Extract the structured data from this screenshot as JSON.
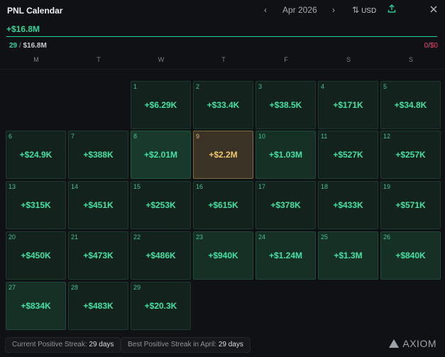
{
  "header": {
    "title": "PNL Calendar",
    "prev_icon": "chevron-left-icon",
    "next_icon": "chevron-right-icon",
    "month_label": "Apr 2026",
    "currency_label": "USD",
    "swap_icon": "swap-vertical-icon",
    "share_icon": "share-upload-icon",
    "close_icon": "close-icon"
  },
  "summary": {
    "total": "+$16.8M",
    "positive_days": "29",
    "positive_total": "$16.8M",
    "negative_days": "0",
    "negative_total": "$0",
    "separator": "/",
    "accent_color": "#31d49a",
    "negative_color": "#ff3c6e",
    "positive_fraction": 1.0
  },
  "weekdays": [
    "M",
    "T",
    "W",
    "T",
    "F",
    "S",
    "S"
  ],
  "days": [
    {
      "day": "1",
      "value": "+$6.29K",
      "tone": "dark"
    },
    {
      "day": "2",
      "value": "+$33.4K",
      "tone": "dark"
    },
    {
      "day": "3",
      "value": "+$38.5K",
      "tone": "dark"
    },
    {
      "day": "4",
      "value": "+$171K",
      "tone": "dark"
    },
    {
      "day": "5",
      "value": "+$34.8K",
      "tone": "dark"
    },
    {
      "day": "6",
      "value": "+$24.9K",
      "tone": "dark"
    },
    {
      "day": "7",
      "value": "+$388K",
      "tone": "dark"
    },
    {
      "day": "8",
      "value": "+$2.01M",
      "tone": "light"
    },
    {
      "day": "9",
      "value": "+$2.2M",
      "tone": "today"
    },
    {
      "day": "10",
      "value": "+$1.03M",
      "tone": "mid"
    },
    {
      "day": "11",
      "value": "+$527K",
      "tone": "dark"
    },
    {
      "day": "12",
      "value": "+$257K",
      "tone": "dark"
    },
    {
      "day": "13",
      "value": "+$315K",
      "tone": "dark"
    },
    {
      "day": "14",
      "value": "+$451K",
      "tone": "dark"
    },
    {
      "day": "15",
      "value": "+$253K",
      "tone": "dark"
    },
    {
      "day": "16",
      "value": "+$615K",
      "tone": "dark"
    },
    {
      "day": "17",
      "value": "+$378K",
      "tone": "dark"
    },
    {
      "day": "18",
      "value": "+$433K",
      "tone": "dark"
    },
    {
      "day": "19",
      "value": "+$571K",
      "tone": "dark"
    },
    {
      "day": "20",
      "value": "+$450K",
      "tone": "dark"
    },
    {
      "day": "21",
      "value": "+$473K",
      "tone": "dark"
    },
    {
      "day": "22",
      "value": "+$486K",
      "tone": "dark"
    },
    {
      "day": "23",
      "value": "+$940K",
      "tone": "mid"
    },
    {
      "day": "24",
      "value": "+$1.24M",
      "tone": "mid"
    },
    {
      "day": "25",
      "value": "+$1.3M",
      "tone": "mid"
    },
    {
      "day": "26",
      "value": "+$840K",
      "tone": "mid"
    },
    {
      "day": "27",
      "value": "+$834K",
      "tone": "mid"
    },
    {
      "day": "28",
      "value": "+$483K",
      "tone": "dark"
    },
    {
      "day": "29",
      "value": "+$20.3K",
      "tone": "dark"
    }
  ],
  "footer": {
    "current_streak_label": "Current Positive Streak:",
    "current_streak_value": "29 days",
    "best_streak_label": "Best Positive Streak in April:",
    "best_streak_value": "29 days",
    "brand": "AXIOM",
    "brand_icon": "axiom-logo-icon"
  }
}
